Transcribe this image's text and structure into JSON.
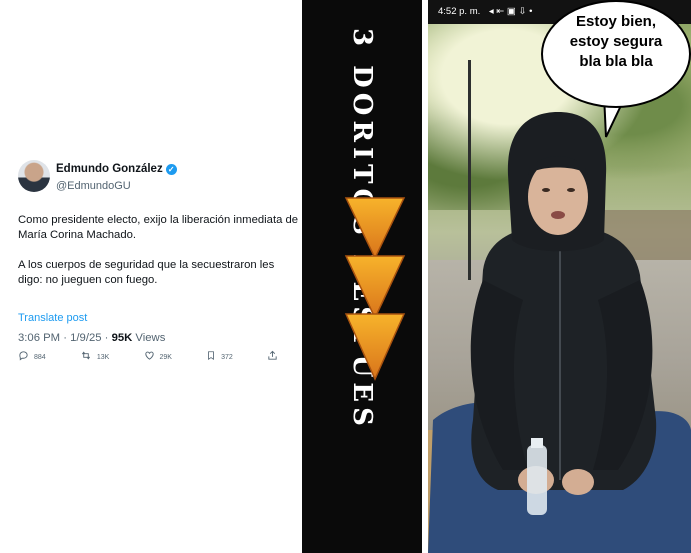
{
  "tweet": {
    "author": "Edmundo González",
    "handle": "@EdmundoGU",
    "paragraph1": "Como presidente electo, exijo la liberación inmediata de María Corina Machado.",
    "paragraph2": "A los cuerpos de seguridad que la secuestraron les digo: no jueguen con fuego.",
    "translate": "Translate post",
    "timestamp": "3:06 PM · 1/9/25 · ",
    "views_count": "95K",
    "views_label": " Views",
    "replies": "884",
    "reposts": "13K",
    "likes": "29K",
    "bookmarks": "372"
  },
  "strip": {
    "text": "3 DORITOS DESPUES"
  },
  "video": {
    "status_time": "4:52 p. m.",
    "status_icons": "◂ ⇤ ▣ ⇩ •"
  },
  "bubble": {
    "line1": "Estoy bien,",
    "line2": "estoy segura",
    "line3": "bla bla bla"
  }
}
